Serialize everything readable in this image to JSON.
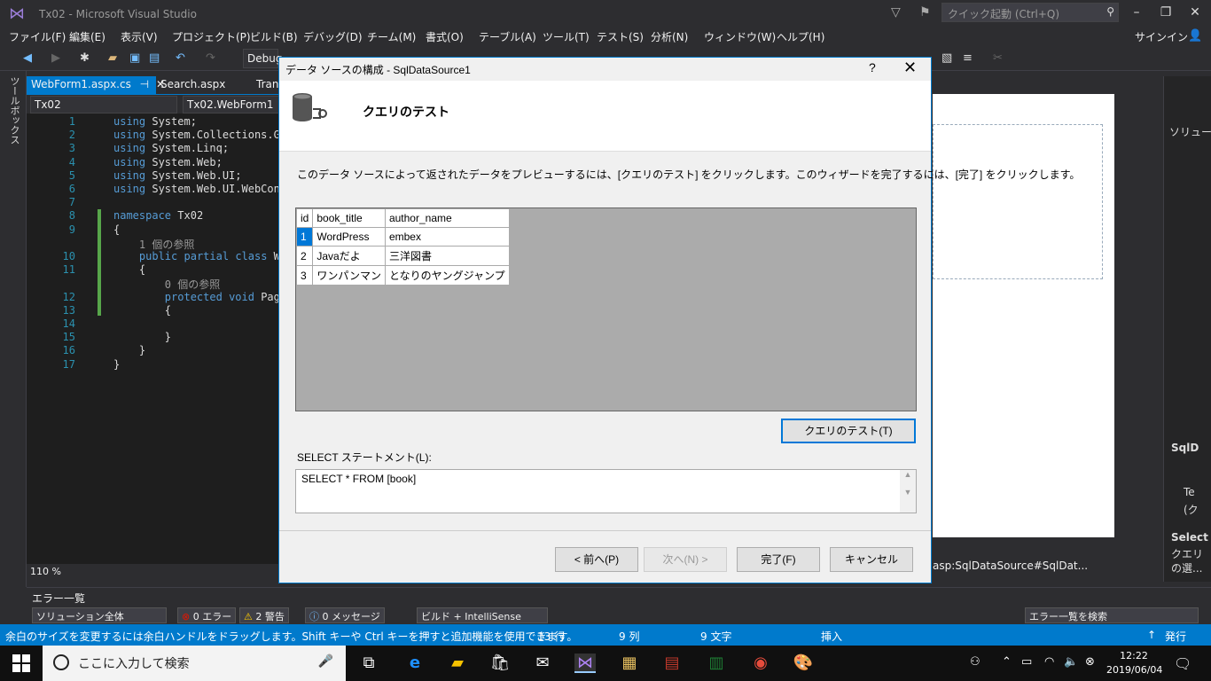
{
  "window": {
    "title": "Tx02 - Microsoft Visual Studio",
    "quick_launch_placeholder": "クイック起動 (Ctrl+Q)",
    "signin": "サインイン"
  },
  "menu": [
    "ファイル(F)",
    "編集(E)",
    "表示(V)",
    "プロジェクト(P)",
    "ビルド(B)",
    "デバッグ(D)",
    "チーム(M)",
    "書式(O)",
    "テーブル(A)",
    "ツール(T)",
    "テスト(S)",
    "分析(N)",
    "ウィンドウ(W)",
    "ヘルプ(H)"
  ],
  "toolbar": {
    "config": "Debug"
  },
  "left_toolbox": "ツールボックス",
  "tabs": [
    {
      "label": "WebForm1.aspx.cs",
      "pin": "⊣",
      "close": "✕"
    },
    {
      "label": "Search.aspx"
    },
    {
      "label": "Tranl"
    }
  ],
  "navbar": {
    "project": "Tx02",
    "class": "Tx02.WebForm1"
  },
  "code_lines": [
    {
      "n": "1",
      "text": "using System;"
    },
    {
      "n": "2",
      "text": "using System.Collections.G"
    },
    {
      "n": "3",
      "text": "using System.Linq;"
    },
    {
      "n": "4",
      "text": "using System.Web;"
    },
    {
      "n": "5",
      "text": "using System.Web.UI;"
    },
    {
      "n": "6",
      "text": "using System.Web.UI.WebCon"
    },
    {
      "n": "7",
      "text": ""
    },
    {
      "n": "8",
      "text": "namespace Tx02"
    },
    {
      "n": "9",
      "text": "{"
    },
    {
      "n": "",
      "text": "    1 個の参照"
    },
    {
      "n": "10",
      "text": "    public partial class W"
    },
    {
      "n": "11",
      "text": "    {"
    },
    {
      "n": "",
      "text": "        0 個の参照"
    },
    {
      "n": "12",
      "text": "        protected void Pag"
    },
    {
      "n": "13",
      "text": "        {"
    },
    {
      "n": "14",
      "text": ""
    },
    {
      "n": "15",
      "text": "        }"
    },
    {
      "n": "16",
      "text": "    }"
    },
    {
      "n": "17",
      "text": "}"
    }
  ],
  "zoom": "110 %",
  "dialog": {
    "title": "データ ソースの構成 - SqlDataSource1",
    "help": "?",
    "close": "✕",
    "header": "クエリのテスト",
    "instruction": "このデータ ソースによって返されたデータをプレビューするには、[クエリのテスト] をクリックします。このウィザードを完了するには、[完了] をクリックします。",
    "columns": [
      "id",
      "book_title",
      "author_name"
    ],
    "rows": [
      [
        "1",
        "WordPress",
        "embex"
      ],
      [
        "2",
        "Javaだよ",
        "三洋図書"
      ],
      [
        "3",
        "ワンパンマン",
        "となりのヤングジャンプ"
      ]
    ],
    "test_query_button": "クエリのテスト(T)",
    "sql_label": "SELECT ステートメント(L):",
    "sql": "SELECT * FROM [book]",
    "buttons": {
      "prev": "< 前へ(P)",
      "next": "次へ(N) >",
      "finish": "完了(F)",
      "cancel": "キャンセル"
    }
  },
  "designer": {
    "tag": "asp:SqlDataSource#SqlDat..."
  },
  "right_panel": {
    "solution": "ソリュー",
    "sqld": "SqlD",
    "te": "Te",
    "ku": "(ク",
    "select": "Select",
    "kueri": "クエリ",
    "nosen": "の選..."
  },
  "error_panel": {
    "title": "エラー一覧",
    "scope": "ソリューション全体",
    "errors": "0 エラー",
    "warnings": "2 警告",
    "messages": "0 メッセージ",
    "build": "ビルド + IntelliSense",
    "search": "エラー一覧を検索"
  },
  "statusbar": {
    "message": "余白のサイズを変更するには余白ハンドルをドラッグします。Shift キーや Ctrl キーを押すと追加機能を使用できます。",
    "line": "13 行",
    "col": "9 列",
    "char": "9 文字",
    "mode": "挿入",
    "publish": "発行"
  },
  "taskbar": {
    "search_placeholder": "ここに入力して検索",
    "time": "12:22",
    "date": "2019/06/04"
  },
  "colors": {
    "accent": "#007acc",
    "selection": "#0078d7",
    "ide_bg": "#2d2d30",
    "editor_bg": "#1e1e1e"
  }
}
